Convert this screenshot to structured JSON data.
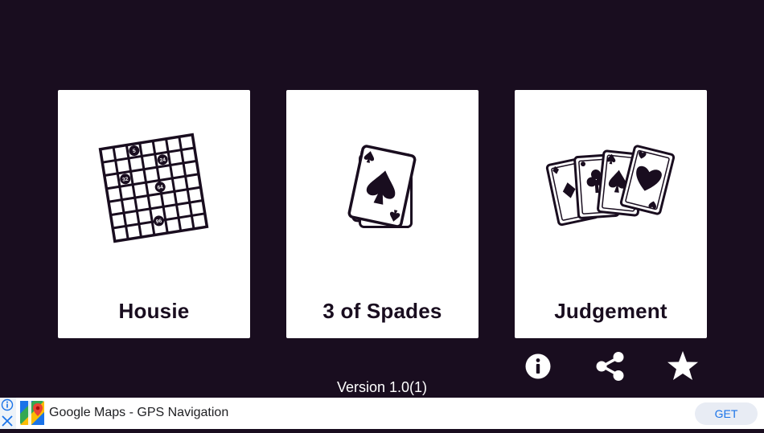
{
  "games": [
    {
      "label": "Housie",
      "icon": "housie-ticket-icon"
    },
    {
      "label": "3 of Spades",
      "icon": "spade-cards-icon"
    },
    {
      "label": "Judgement",
      "icon": "fanned-cards-icon"
    }
  ],
  "housie_numbers": [
    "5",
    "24",
    "32",
    "64",
    "96"
  ],
  "actions": {
    "info_icon": "info-icon",
    "share_icon": "share-icon",
    "rate_icon": "star-icon"
  },
  "version": "Version 1.0(1)",
  "ad": {
    "app_name": "Google Maps - GPS Navigation",
    "button": "GET",
    "icon": "google-maps-app-icon"
  },
  "colors": {
    "background": "#190d1f",
    "card": "#ffffff",
    "accent": "#1a73e8"
  }
}
